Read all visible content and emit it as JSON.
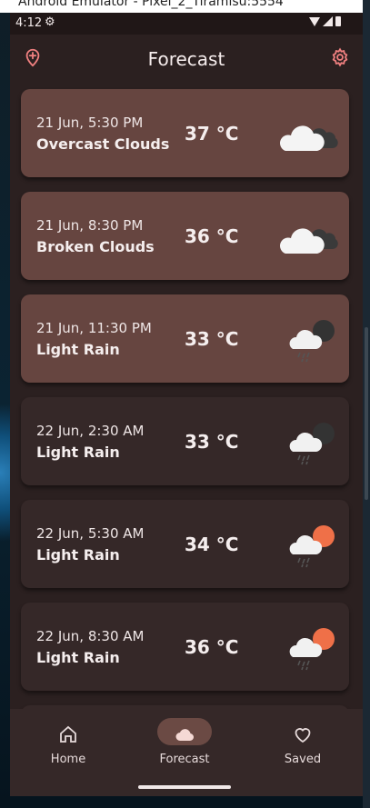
{
  "emulator": {
    "title": "Android Emulator - Pixel_2_Tiramisu:5554"
  },
  "status_bar": {
    "time": "4:12"
  },
  "app_bar": {
    "title": "Forecast"
  },
  "forecast": [
    {
      "date": "21 Jun, 5:30 PM",
      "condition": "Overcast Clouds",
      "temp": "37 °C",
      "icon": "overcast-clouds-icon",
      "highlight": true
    },
    {
      "date": "21 Jun, 8:30 PM",
      "condition": "Broken Clouds",
      "temp": "36 °C",
      "icon": "broken-clouds-icon",
      "highlight": true
    },
    {
      "date": "21 Jun, 11:30 PM",
      "condition": "Light Rain",
      "temp": "33 °C",
      "icon": "rain-night-icon",
      "highlight": true
    },
    {
      "date": "22 Jun, 2:30 AM",
      "condition": "Light Rain",
      "temp": "33 °C",
      "icon": "rain-night-icon",
      "highlight": false
    },
    {
      "date": "22 Jun, 5:30 AM",
      "condition": "Light Rain",
      "temp": "34 °C",
      "icon": "rain-sun-icon",
      "highlight": false
    },
    {
      "date": "22 Jun, 8:30 AM",
      "condition": "Light Rain",
      "temp": "36 °C",
      "icon": "rain-sun-icon",
      "highlight": false
    }
  ],
  "bottom_nav": {
    "items": [
      {
        "label": "Home",
        "icon": "home-icon",
        "selected": false
      },
      {
        "label": "Forecast",
        "icon": "cloud-icon",
        "selected": true
      },
      {
        "label": "Saved",
        "icon": "heart-icon",
        "selected": false
      }
    ]
  },
  "colors": {
    "accent": "#f08080",
    "card_highlight": "#664540",
    "card_default": "#352828",
    "background": "#2b2020"
  }
}
